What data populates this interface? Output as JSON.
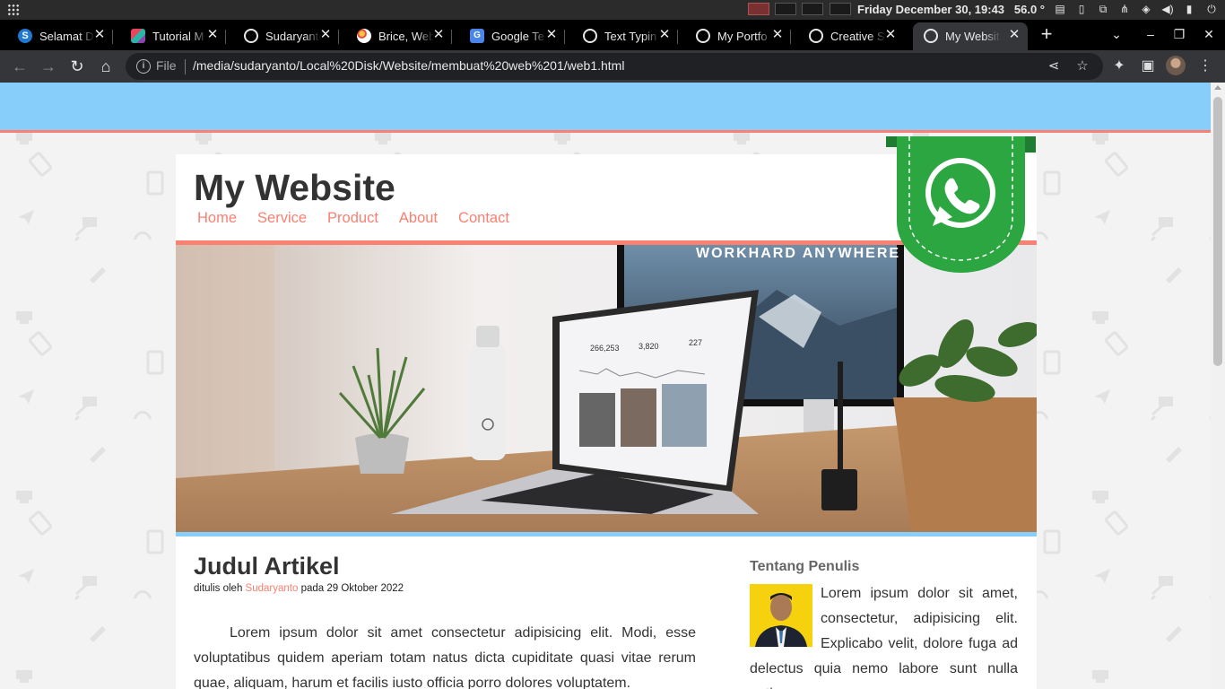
{
  "os": {
    "clock": "Friday December 30, 19:43",
    "temperature": "56.0 °"
  },
  "browser": {
    "tabs": [
      {
        "label": "Selamat D",
        "icon": "skype-icon"
      },
      {
        "label": "Tutorial M",
        "icon": "cube-icon"
      },
      {
        "label": "Sudaryanto",
        "icon": "globe-icon"
      },
      {
        "label": "Brice, Web",
        "icon": "brice-icon"
      },
      {
        "label": "Google Te",
        "icon": "google-translate-icon"
      },
      {
        "label": "Text Typin",
        "icon": "globe-icon"
      },
      {
        "label": "My Portfo",
        "icon": "globe-icon"
      },
      {
        "label": "Creative SI",
        "icon": "globe-icon"
      },
      {
        "label": "My Websit",
        "icon": "globe-icon",
        "active": true
      }
    ],
    "address": {
      "scheme_label": "File",
      "url": "/media/sudaryanto/Local%20Disk/Website/membuat%20web%201/web1.html"
    }
  },
  "site": {
    "title": "My Website",
    "menu": [
      "Home",
      "Service",
      "Product",
      "About",
      "Contact"
    ],
    "colors": {
      "accent": "#fa8072",
      "band": "#87cefa",
      "whatsapp": "#2ba640"
    }
  },
  "article": {
    "title": "Judul Artikel",
    "meta_prefix": "ditulis oleh",
    "author": "Sudaryanto",
    "meta_suffix": "pada 29 Oktober 2022",
    "body": "Lorem ipsum dolor sit amet consectetur adipisicing elit. Modi, esse voluptatibus quidem aperiam totam natus dicta cupiditate quasi vitae rerum quae, aliquam, harum et facilis iusto officia porro dolores voluptatem."
  },
  "sidebar": {
    "title": "Tentang Penulis",
    "bio": "Lorem ipsum dolor sit amet, consectetur, adipisicing elit. Explicabo velit, dolore fuga ad delectus quia nemo labore sunt nulla optio"
  },
  "hero": {
    "screen_text": "WORKHARD ANYWHERE",
    "stat_1": "266,253",
    "stat_2": "3,820",
    "stat_3": "227"
  }
}
